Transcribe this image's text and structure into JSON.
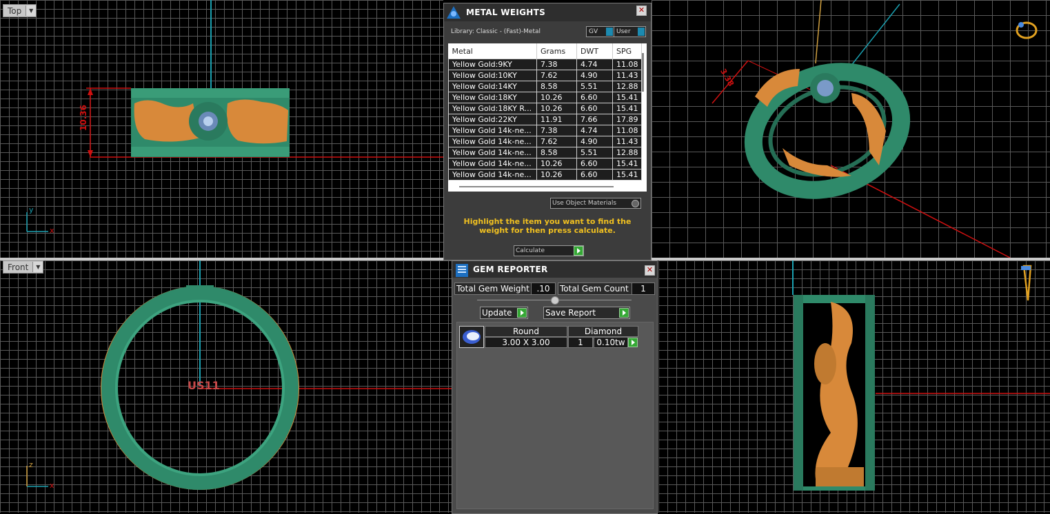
{
  "viewports": {
    "top": {
      "label": "Top",
      "dimension": "10.36",
      "axis_x": "x",
      "axis_y": "y"
    },
    "front": {
      "label": "Front",
      "ring_size": "US11",
      "axis_x": "x",
      "axis_z": "z"
    },
    "perspective": {
      "dimension": "3.38"
    }
  },
  "metal_weights": {
    "title": "METAL WEIGHTS",
    "library": "Library: Classic - (Fast)-Metal",
    "toggle_gv": "GV",
    "toggle_user": "User",
    "columns": [
      "Metal",
      "Grams",
      "DWT",
      "SPG"
    ],
    "rows": [
      [
        "Yellow Gold:9KY",
        "7.38",
        "4.74",
        "11.08"
      ],
      [
        "Yellow Gold:10KY",
        "7.62",
        "4.90",
        "11.43"
      ],
      [
        "Yellow Gold:14KY",
        "8.58",
        "5.51",
        "12.88"
      ],
      [
        "Yellow Gold:18KY",
        "10.26",
        "6.60",
        "15.41"
      ],
      [
        "Yellow Gold:18KY R...",
        "10.26",
        "6.60",
        "15.41"
      ],
      [
        "Yellow Gold:22KY",
        "11.91",
        "7.66",
        "17.89"
      ],
      [
        "Yellow Gold 14k-ne...",
        "7.38",
        "4.74",
        "11.08"
      ],
      [
        "Yellow Gold 14k-ne...",
        "7.62",
        "4.90",
        "11.43"
      ],
      [
        "Yellow Gold 14k-ne...",
        "8.58",
        "5.51",
        "12.88"
      ],
      [
        "Yellow Gold 14k-ne...",
        "10.26",
        "6.60",
        "15.41"
      ],
      [
        "Yellow Gold 14k-ne...",
        "10.26",
        "6.60",
        "15.41"
      ]
    ],
    "use_object_materials": "Use Object Materials",
    "hint": "Highlight the item you want to find the weight for then press calculate.",
    "calculate": "Calculate"
  },
  "gem_reporter": {
    "title": "GEM REPORTER",
    "total_gem_weight_label": "Total Gem Weight",
    "total_gem_weight": ".10",
    "total_gem_count_label": "Total Gem Count",
    "total_gem_count": "1",
    "update": "Update",
    "save_report": "Save Report",
    "gem": {
      "shape": "Round",
      "type": "Diamond",
      "size": "3.00 X 3.00",
      "count": "1",
      "weight": "0.10tw"
    }
  },
  "colors": {
    "ring_green": "#2f8a6a",
    "gold": "#d8893a",
    "dim_red": "#d01010",
    "axis_cyan": "#1aa0b0",
    "hint_yellow": "#f0c020"
  }
}
